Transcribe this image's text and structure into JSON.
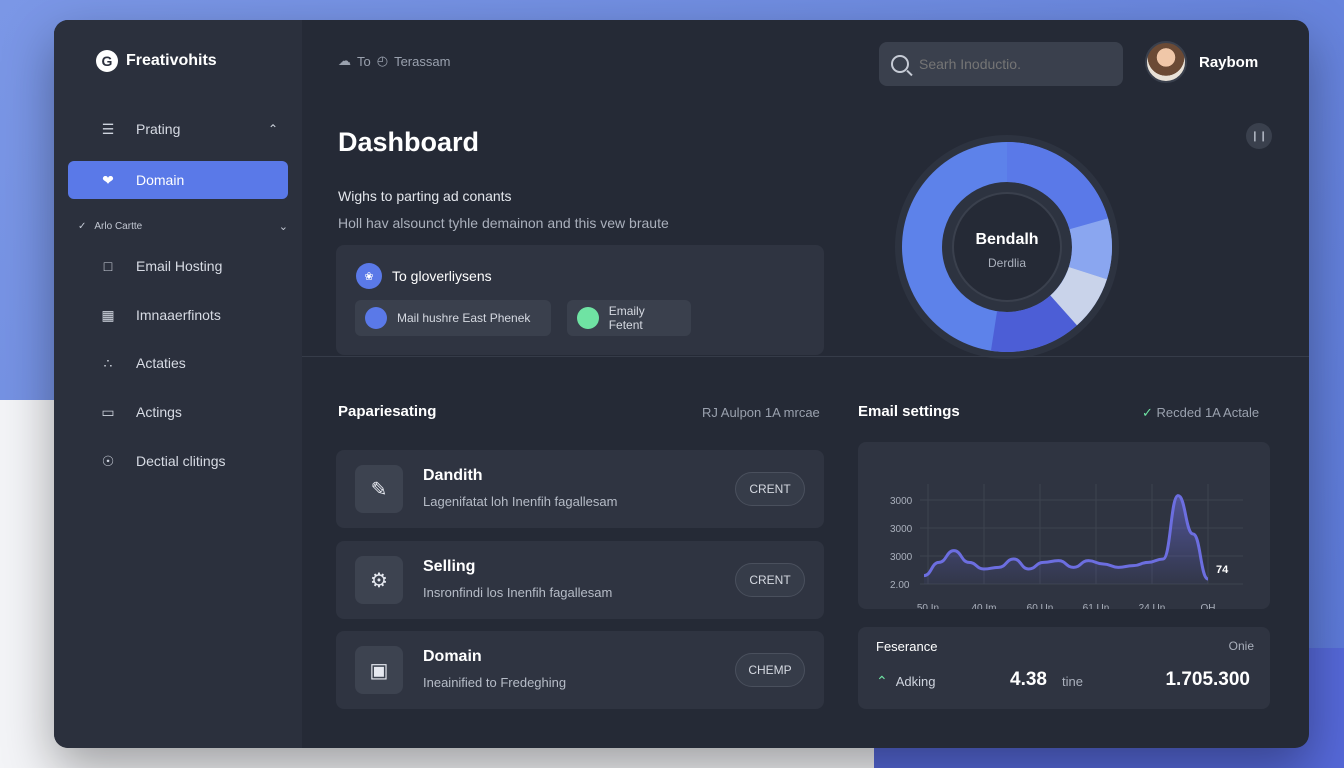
{
  "app": {
    "brand": "Freativohits",
    "brand_icon": "G"
  },
  "sidebar": {
    "items": [
      {
        "label": "Prating",
        "icon": "list-icon"
      },
      {
        "label": "Domain",
        "icon": "heart-icon"
      },
      {
        "label": "Email Hosting",
        "icon": "calendar-icon"
      },
      {
        "label": "Imnaaerfinots",
        "icon": "building-icon"
      },
      {
        "label": "Actaties",
        "icon": "sparkle-icon"
      },
      {
        "label": "Actings",
        "icon": "monitor-icon"
      },
      {
        "label": "Dectial clitings",
        "icon": "money-icon"
      }
    ],
    "section_label": "Arlo Cartte"
  },
  "header": {
    "breadcrumb_a": "To",
    "breadcrumb_b": "Terassam",
    "search_placeholder": "Searh Inoductio.",
    "username": "Raybom"
  },
  "main": {
    "title": "Dashboard",
    "subtitle": "Wighs to parting ad conants",
    "description": "Holl hav alsounct tyhle demainon and this vew braute",
    "info_card": {
      "heading": "To gloverliysens",
      "chip1": "Mail hushre  East Phenek",
      "chip2": "Emaily Fetent"
    },
    "donut": {
      "title": "Bendalh",
      "subtitle": "Derdlia"
    }
  },
  "colors": {
    "accent": "#5a79e8",
    "green": "#6fe3a3",
    "chart_line": "#6c6ee0"
  },
  "list_section": {
    "title": "Papariesating",
    "meta": "RJ Aulpon 1A mrcae",
    "cards": [
      {
        "title": "Dandith",
        "sub": "Lagenifatat loh Inenfih fagallesam",
        "button": "CRENT",
        "icon": "pencil-icon"
      },
      {
        "title": "Selling",
        "sub": "Insronfindi los Inenfih fagallesam",
        "button": "CRENT",
        "icon": "gear-icon"
      },
      {
        "title": "Domain",
        "sub": "Ineainified to Fredeghing",
        "button": "CHEMP",
        "icon": "box-icon"
      }
    ]
  },
  "email_section": {
    "title": "Email settings",
    "meta": "Recded 1A Actale"
  },
  "chart_data": {
    "type": "area",
    "y_ticks": [
      "3000",
      "3000",
      "3000",
      "2.00"
    ],
    "x_ticks": [
      "50 In",
      "40 Im",
      "60 Un",
      "61 Un",
      "24 Un",
      "OH"
    ],
    "end_label": "74",
    "x": [
      0,
      1,
      2,
      3,
      4,
      5,
      6,
      7,
      8,
      9,
      10,
      11,
      12,
      13,
      14,
      15,
      16,
      17,
      18,
      19
    ],
    "values": [
      0.5,
      1.3,
      2.0,
      1.3,
      0.9,
      1.0,
      1.5,
      0.9,
      1.3,
      1.4,
      1.0,
      1.4,
      1.2,
      1.0,
      1.1,
      1.3,
      1.5,
      5.3,
      3.0,
      0.3
    ]
  },
  "stats": {
    "title": "Feserance",
    "right": "Onie",
    "trend": "Adking",
    "mid_value": "4.38",
    "mid_unit": "tine",
    "big_value": "1.705.300"
  }
}
